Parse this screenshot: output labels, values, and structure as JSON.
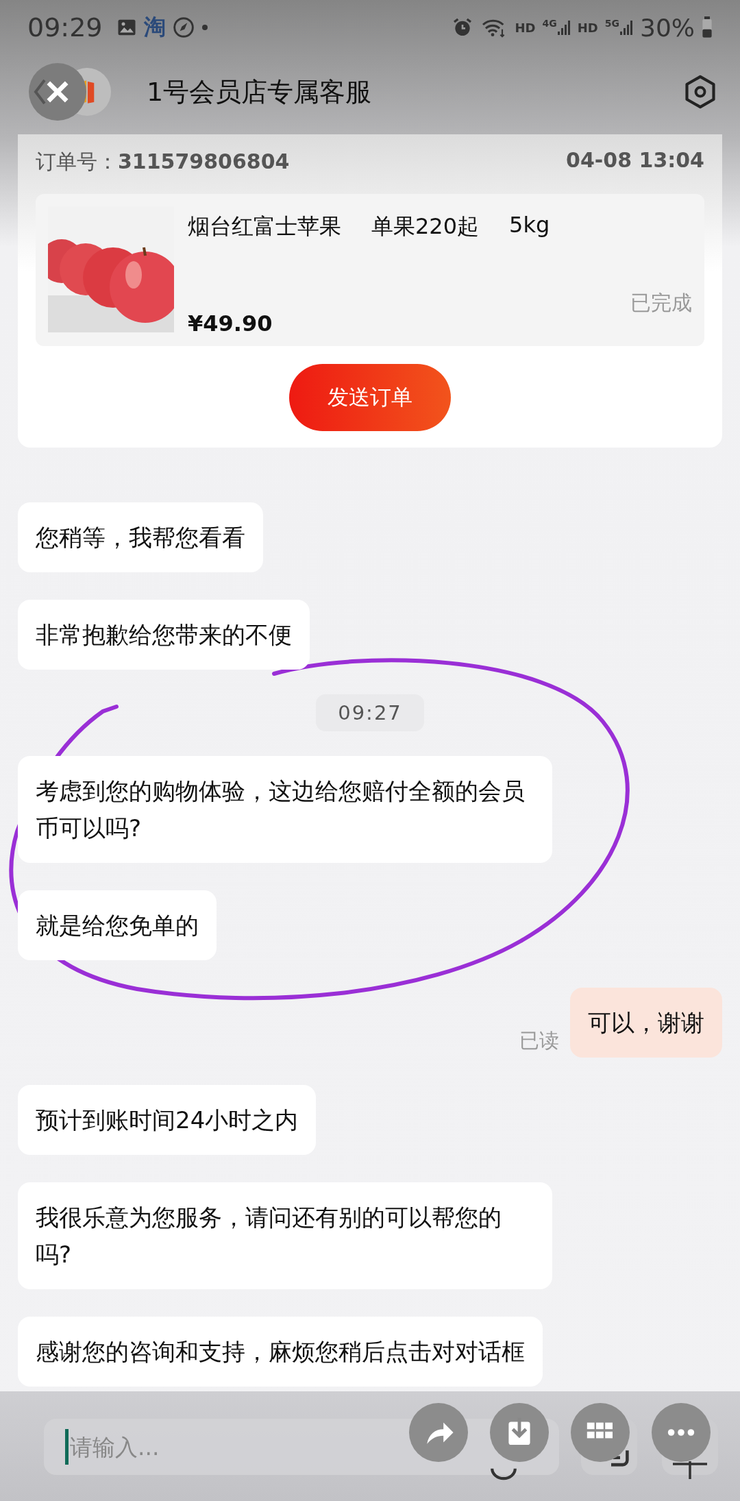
{
  "status_bar": {
    "time": "09:29",
    "app_glyph": "淘",
    "hd_1": "HD",
    "net_1": "4G",
    "hd_2": "HD",
    "net_2": "5G",
    "battery": "30%"
  },
  "header": {
    "title": "1号会员店专属客服"
  },
  "order_card": {
    "order_label": "订单号：",
    "order_number": "311579806804",
    "date": "04-08 13:04",
    "product": {
      "name": "烟台红富士苹果",
      "spec": "单果220起",
      "weight": "5kg",
      "price": "¥49.90",
      "status": "已完成"
    },
    "send_button": "发送订单"
  },
  "messages": [
    {
      "kind": "incoming",
      "text": "您稍等，我帮您看看"
    },
    {
      "kind": "incoming",
      "text": "非常抱歉给您带来的不便"
    },
    {
      "kind": "time",
      "text": "09:27"
    },
    {
      "kind": "incoming",
      "text": "考虑到您的购物体验，这边给您赔付全额的会员币可以吗?"
    },
    {
      "kind": "incoming",
      "text": "就是给您免单的"
    },
    {
      "kind": "outgoing",
      "text": "可以，谢谢",
      "receipt": "已读"
    },
    {
      "kind": "incoming",
      "text": "预计到账时间24小时之内"
    },
    {
      "kind": "incoming",
      "text": "我很乐意为您服务，请问还有别的可以帮您的吗?"
    },
    {
      "kind": "incoming",
      "text": "感谢您的咨询和支持，麻烦您稍后点击对对话框"
    }
  ],
  "input": {
    "placeholder": "请输入..."
  }
}
